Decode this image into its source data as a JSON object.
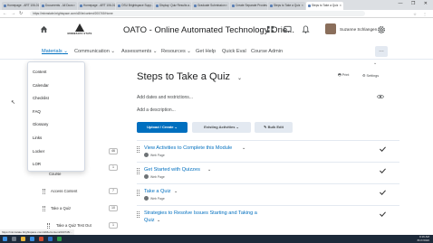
{
  "browser": {
    "tabs": [
      {
        "label": "Homepage - ART 106-01"
      },
      {
        "label": "Documents - All Docs"
      },
      {
        "label": "Homepage - ART 106-01"
      },
      {
        "label": "OSU Brightspace Supp..."
      },
      {
        "label": "Display: Quiz Results a..."
      },
      {
        "label": "Graduate Submission"
      },
      {
        "label": "Create Separate Proxies"
      },
      {
        "label": "Steps to Take a Quiz"
      },
      {
        "label": "Steps to Take a Quiz"
      }
    ],
    "url": "https://minnstate.brightspace.com/d2l/le/content/200745/Home",
    "window_controls": "— ❐ ✕"
  },
  "header": {
    "logo_text": "MINNESOTA STATE",
    "course_title": "OATO - Online Automated Technology Orie...",
    "user_name": "Suzanne Schlangen"
  },
  "navbar": {
    "items": [
      "Materials",
      "Communication",
      "Assessments",
      "Resources",
      "Get Help",
      "Quick Eval",
      "Course Admin"
    ],
    "more_label": "…"
  },
  "dropdown": {
    "items": [
      "Content",
      "Calendar",
      "Checklist",
      "FAQ",
      "Glossary",
      "Links",
      "Locker",
      "LOR"
    ]
  },
  "left_panel": {
    "rows": [
      {
        "label": "Course",
        "count": "1"
      },
      {
        "label": "Access Content",
        "count": "7"
      },
      {
        "label": "Take a Quiz",
        "count": "10"
      },
      {
        "label": "Take a Quiz Test Out",
        "count": "1"
      }
    ],
    "top_count": "46"
  },
  "main": {
    "title": "Steps to Take a Quiz",
    "print_label": "Print",
    "settings_label": "Settings",
    "dates_link": "Add dates and restrictions...",
    "description_link": "Add a description...",
    "upload_button": "Upload / Create",
    "existing_button": "Existing Activities",
    "bulk_button": "Bulk Edit",
    "topics": [
      {
        "title": "View Activities to Complete this Module",
        "type": "Web Page"
      },
      {
        "title": "Get Started with Quizzes",
        "type": "Web Page"
      },
      {
        "title": "Take a Quiz",
        "type": "Web Page"
      },
      {
        "title": "Strategies to Resolve Issues Starting and Taking a",
        "title2": "Quiz",
        "type": ""
      }
    ]
  },
  "status_url": "https://minnstate.brightspace.com/d2l/le/content/200745/...",
  "taskbar": {
    "time": "9:16 AM",
    "date": "8/17/2020"
  },
  "colors": {
    "accent": "#006fbf",
    "nav_text": "#494c4e",
    "taskbar": "#1d2a3a"
  }
}
